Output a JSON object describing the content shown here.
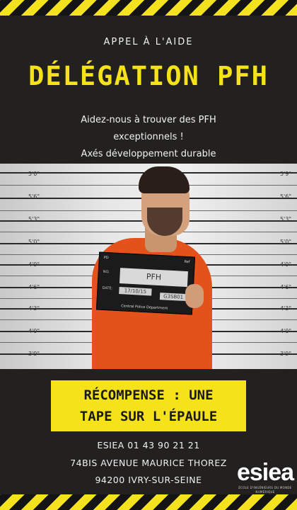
{
  "header": {
    "kicker": "APPEL À L'AIDE",
    "title": "DÉLÉGATION PFH",
    "subtitle_lines": [
      "Aidez-nous à trouver des PFH",
      "exceptionnels !",
      "Axés développement durable"
    ]
  },
  "photo": {
    "height_labels": [
      {
        "left": "5'0\"",
        "right": "5'9\""
      },
      {
        "left": "5'6\"",
        "right": "5'6\""
      },
      {
        "left": "5'3\"",
        "right": "5'3\""
      },
      {
        "left": "5'0\"",
        "right": "5'0\""
      },
      {
        "left": "4'9\"",
        "right": "4'9\""
      },
      {
        "left": "4'6\"",
        "right": "4'6\""
      },
      {
        "left": "4'3\"",
        "right": "4'3\""
      },
      {
        "left": "4'0\"",
        "right": "4'0\""
      },
      {
        "left": "3'9\"",
        "right": "3'9\""
      }
    ],
    "board": {
      "header_cells": [
        "PD",
        "Ref"
      ],
      "name_label": "NO.",
      "plate_text": "PFH",
      "date_label": "DATE:",
      "date_value": "17/10/15",
      "number_value": "G3SB01",
      "footer": "Central Police Department"
    }
  },
  "reward": {
    "line1": "RÉCOMPENSE : UNE",
    "line2": "TAPE SUR L'ÉPAULE"
  },
  "contact": {
    "phone": "ESIEA 01 43 90 21 21",
    "address": "74BIS AVENUE MAURICE THOREZ",
    "city": "94200 IVRY-SUR-SEINE"
  },
  "logo": {
    "word": "esiea",
    "tagline": "ÉCOLE D'INGÉNIEURS DU MONDE NUMÉRIQUE"
  },
  "colors": {
    "background": "#222120",
    "accent_yellow": "#f6e21a",
    "jumpsuit_orange": "#e4521b"
  }
}
